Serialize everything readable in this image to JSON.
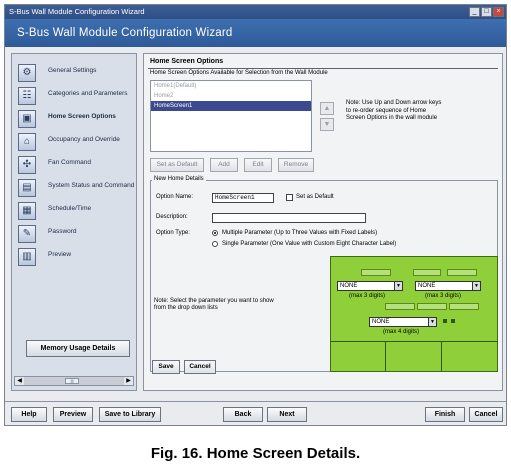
{
  "window": {
    "title": "S-Bus Wall Module Configuration Wizard",
    "banner": "S-Bus Wall Module Configuration Wizard"
  },
  "sidebar": {
    "items": [
      {
        "label": "General Settings",
        "icon": "settings-icon"
      },
      {
        "label": "Categories and Parameters",
        "icon": "categories-icon"
      },
      {
        "label": "Home Screen Options",
        "icon": "home-screen-icon"
      },
      {
        "label": "Occupancy and Override",
        "icon": "occupancy-icon"
      },
      {
        "label": "Fan Command",
        "icon": "fan-icon"
      },
      {
        "label": "System Status and Command",
        "icon": "system-status-icon"
      },
      {
        "label": "Schedule/Time",
        "icon": "schedule-icon"
      },
      {
        "label": "Password",
        "icon": "password-icon"
      },
      {
        "label": "Preview",
        "icon": "preview-icon"
      }
    ],
    "active_index": 2,
    "memory_button": "Memory Usage Details"
  },
  "home_screen": {
    "title": "Home Screen Options",
    "subtitle": "Home Screen Options Available for Selection from the Wall Module",
    "options": [
      "Home1(Default)",
      "Home2",
      "HomeScreen1"
    ],
    "selected_index": 2,
    "note": "Note: Use Up and Down arrow keys to re-order sequence of Home Screen Options in the wall module",
    "buttons": {
      "set_default": "Set as Default",
      "add": "Add",
      "edit": "Edit",
      "remove": "Remove"
    }
  },
  "details": {
    "legend": "New Home Details",
    "option_name_label": "Option Name:",
    "option_name_value": "HomeScreen1",
    "set_default_label": "Set as Default",
    "description_label": "Description:",
    "description_value": "",
    "option_type_label": "Option Type:",
    "type_multi": "Multiple Parameter (Up to Three Values with Fixed Labels)",
    "type_single": "Single Parameter (One Value with Custom Eight Character Label)",
    "selected_type": "multi",
    "note": "Note: Select the parameter you want to show from the drop down lists",
    "combo1": "NONE",
    "combo2": "NONE",
    "combo3": "NONE",
    "max3_left": "(max 3 digits)",
    "max3_right": "(max 3 digits)",
    "max4": "(max 4 digits)",
    "save": "Save",
    "cancel": "Cancel"
  },
  "footer": {
    "help": "Help",
    "preview": "Preview",
    "save_library": "Save to Library",
    "back": "Back",
    "next": "Next",
    "finish": "Finish",
    "cancel": "Cancel"
  },
  "caption": "Fig. 16. Home Screen Details."
}
